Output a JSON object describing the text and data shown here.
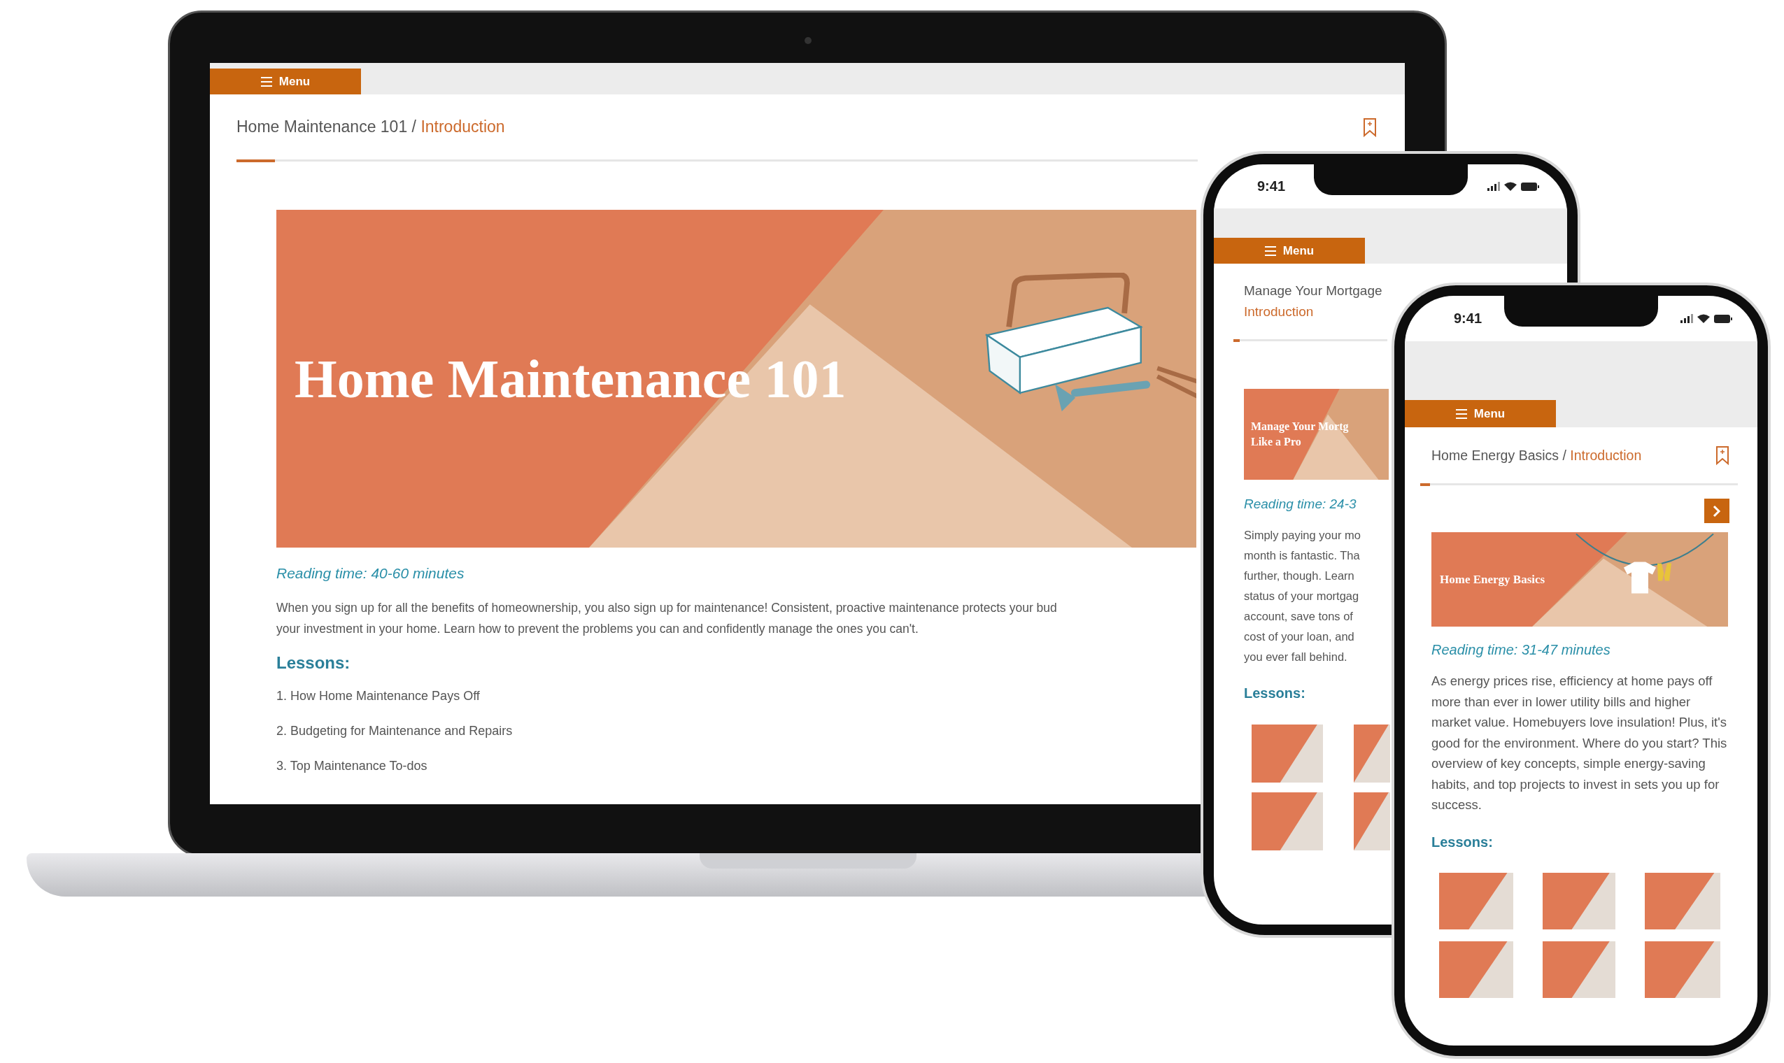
{
  "laptop": {
    "menu_button": {
      "label": "Menu"
    },
    "breadcrumb": {
      "course": "Home Maintenance 101",
      "separator": "/",
      "current": "Introduction"
    },
    "bookmark": true,
    "progress": {
      "level": 0.04
    },
    "has_next_button": false,
    "banner": {
      "kind": "toolbox",
      "title_lines": [
        "Home Maintenance 101"
      ]
    },
    "reading_time": "Reading time: 40-60 minutes",
    "description_lines": [
      "When you sign up for all the benefits of homeownership, you also sign up for maintenance! Consistent, proactive maintenance protects your bud",
      "your investment in your home. Learn how to prevent the problems you can and confidently manage the ones you can't."
    ],
    "lessons_heading": "Lessons:",
    "lessons": [
      "1. How Home Maintenance Pays Off",
      "2. Budgeting for Maintenance and Repairs",
      "3. Top Maintenance To-dos"
    ]
  },
  "phones": [
    {
      "status_time": "9:41",
      "menu_button": {
        "label": "Menu"
      },
      "breadcrumb": {
        "course": "Manage Your Mortgage",
        "current": "Introduction"
      },
      "bookmark": false,
      "progress": {
        "level": 0.04
      },
      "has_next_button": false,
      "banner": {
        "kind": "plain",
        "title_lines": [
          "Manage Your Mortg",
          "Like a Pro"
        ]
      },
      "reading_time": "Reading time: 24-3",
      "description_lines": [
        "Simply paying your mo",
        "month is fantastic. Tha",
        "further, though. Learn",
        "status of your mortgag",
        "account, save tons of",
        "cost of your loan, and",
        "you ever fall behind."
      ],
      "lessons_heading": "Lessons:",
      "lesson_thumbnails": [
        {
          "kind": "full"
        },
        {
          "kind": "cropped"
        },
        {
          "kind": "full"
        },
        {
          "kind": "cropped"
        }
      ]
    },
    {
      "status_time": "9:41",
      "menu_button": {
        "label": "Menu"
      },
      "breadcrumb": {
        "course": "Home Energy Basics",
        "separator": "/",
        "current": "Introduction"
      },
      "bookmark": true,
      "progress": {
        "level": 0.03
      },
      "has_next_button": true,
      "banner": {
        "kind": "clothesline",
        "title_lines": [
          "Home Energy Basics"
        ]
      },
      "reading_time": "Reading time: 31-47 minutes",
      "description": "As energy prices rise, efficiency at home pays off more than ever in lower utility bills and higher market value. Homebuyers love insulation! Plus, it's good for the environment. Where do you start? This overview of key concepts, simple energy-saving habits, and top projects to invest in sets you up for success.",
      "lessons_heading": "Lessons:",
      "lesson_thumbnails": [
        {
          "kind": "full"
        },
        {
          "kind": "full"
        },
        {
          "kind": "full"
        },
        {
          "kind": "full"
        },
        {
          "kind": "full"
        },
        {
          "kind": "full"
        }
      ]
    }
  ]
}
